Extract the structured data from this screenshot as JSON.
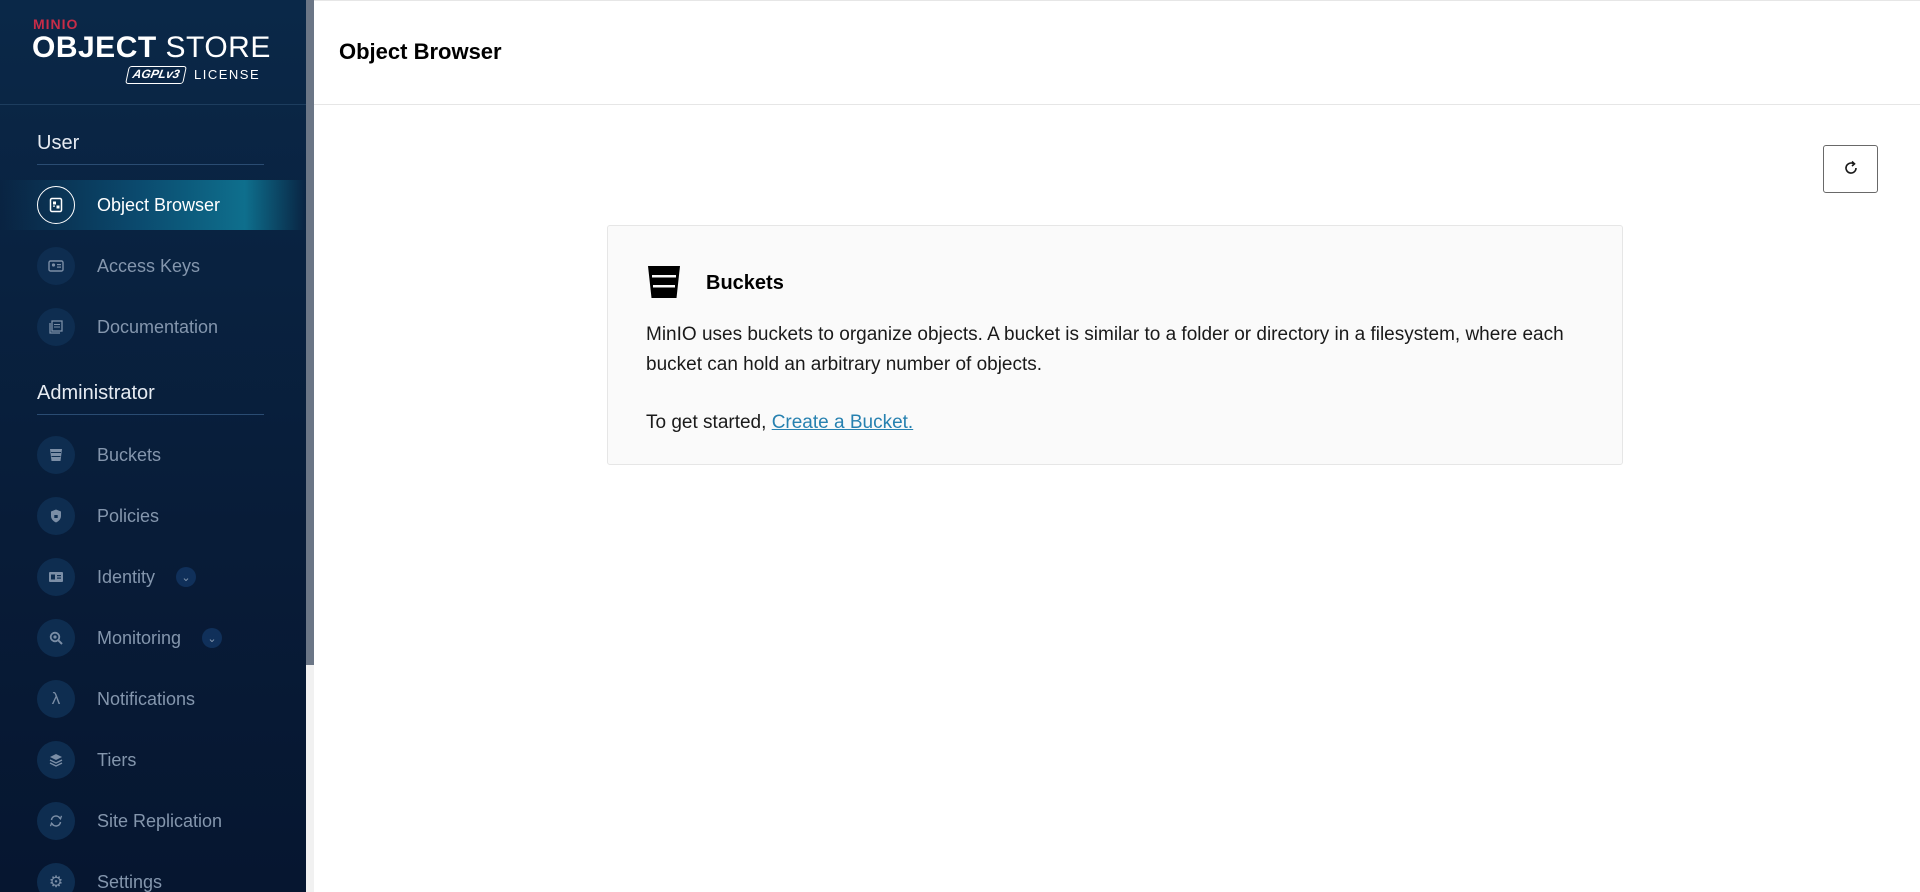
{
  "brand": {
    "company": "MINIO",
    "product_bold": "OBJECT",
    "product_rest": " STORE",
    "license_badge": "AGPLv3",
    "license_text": "LICENSE"
  },
  "sidebar": {
    "user_section": "User",
    "admin_section": "Administrator",
    "user_items": [
      {
        "label": "Object Browser",
        "icon": "object-browser-icon",
        "active": true
      },
      {
        "label": "Access Keys",
        "icon": "access-keys-icon"
      },
      {
        "label": "Documentation",
        "icon": "documentation-icon"
      }
    ],
    "admin_items": [
      {
        "label": "Buckets",
        "icon": "bucket-icon"
      },
      {
        "label": "Policies",
        "icon": "shield-icon"
      },
      {
        "label": "Identity",
        "icon": "id-card-icon",
        "expandable": true
      },
      {
        "label": "Monitoring",
        "icon": "magnifier-icon",
        "expandable": true
      },
      {
        "label": "Notifications",
        "icon": "lambda-icon",
        "glyph": "λ"
      },
      {
        "label": "Tiers",
        "icon": "layers-icon"
      },
      {
        "label": "Site Replication",
        "icon": "sync-icon"
      },
      {
        "label": "Settings",
        "icon": "gear-icon"
      }
    ]
  },
  "header": {
    "title": "Object Browser"
  },
  "card": {
    "title": "Buckets",
    "description": "MinIO uses buckets to organize objects. A bucket is similar to a folder or directory in a filesystem, where each bucket can hold an arbitrary number of objects.",
    "cta_prefix": "To get started, ",
    "cta_link": "Create a Bucket."
  },
  "colors": {
    "sidebar_bg": "#081c38",
    "brand_red": "#c72c48",
    "link": "#2781b0",
    "active_item": "#0e6f8d"
  }
}
